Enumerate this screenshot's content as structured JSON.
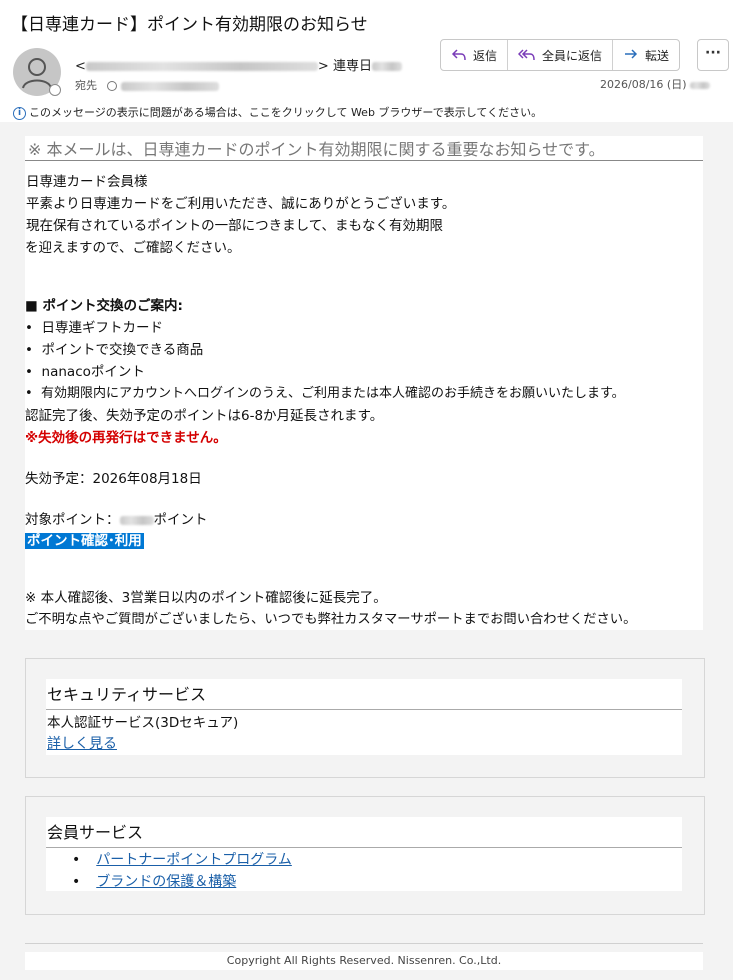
{
  "subject": "【日専連カード】ポイント有効期限のお知らせ",
  "sender": {
    "open_bracket": "<",
    "close_bracket": ">",
    "name": "連専日",
    "to_label": "宛先"
  },
  "actions": [
    {
      "label": "返信",
      "icon": "reply-icon"
    },
    {
      "label": "全員に返信",
      "icon": "reply-all-icon"
    },
    {
      "label": "転送",
      "icon": "forward-icon"
    }
  ],
  "more_label": "···",
  "date": "2026/08/16 (日)",
  "info_bar": "このメッセージの表示に問題がある場合は、ここをクリックして Web ブラウザーで表示してください。",
  "body": {
    "notice": "※ 本メールは、日専連カードのポイント有効期限に関する重要なお知らせです。",
    "greeting": "日専連カード会員様",
    "p1": "平素より日専連カードをご利用いただき、誠にありがとうございます。",
    "p2a": "現在保有されているポイントの一部につきまして、まもなく有効期限",
    "p2b": "を迎えますので、ご確認ください。",
    "section_mark": "■",
    "section_title": "ポイント交換のご案内:",
    "bullets": [
      "日専連ギフトカード",
      "ポイントで交換できる商品",
      "nanacoポイント",
      "有効期限内にアカウントへログインのうえ、ご利用または本人確認のお手続きをお願いいたします。"
    ],
    "extend": "認証完了後、失効予定のポイントは6-8か月延長されます。",
    "warning": "※失効後の再発行はできません。",
    "expiry": "失効予定：2026年08月18日",
    "points_prefix": "対象ポイント：",
    "points_suffix": "ポイント",
    "cta": "ポイント確認･利用",
    "note1": "※ 本人確認後、3営業日以内のポイント確認後に延長完了。",
    "note2": "ご不明な点やご質問がございましたら、いつでも弊社カスタマーサポートまでお問い合わせください。"
  },
  "security": {
    "title": "セキュリティサービス",
    "text": "本人認証サービス(3Dセキュア)",
    "link": "詳しく見る"
  },
  "member": {
    "title": "会員サービス",
    "links": [
      "パートナーポイントプログラム",
      "ブランドの保護＆構築"
    ]
  },
  "footer": "Copyright All Rights Reserved. Nissenren. Co.,Ltd.",
  "colors": {
    "accent": "#0078d4",
    "warning": "#d40000",
    "link": "#1a5fa8"
  }
}
